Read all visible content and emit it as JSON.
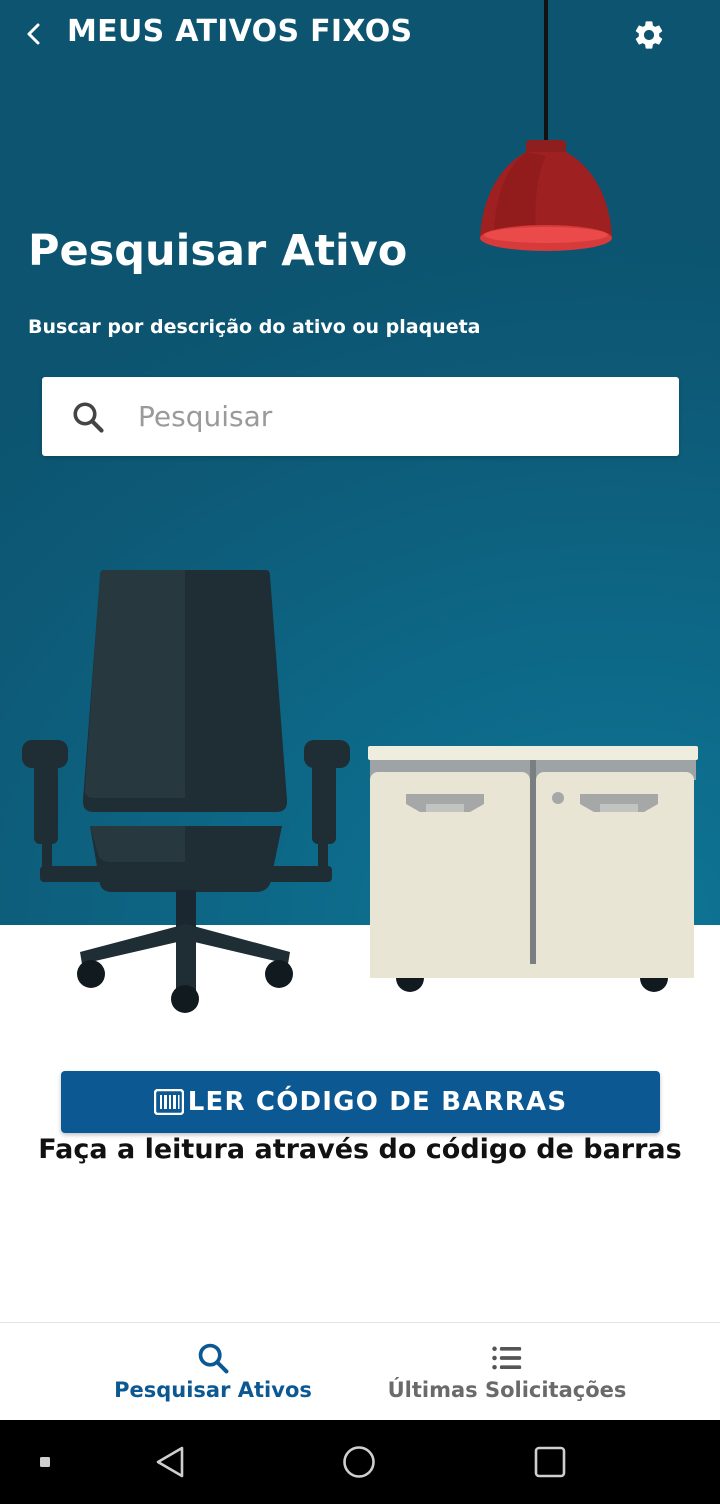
{
  "header": {
    "title": "MEUS ATIVOS FIXOS",
    "back_icon": "chevron-left-icon",
    "settings_icon": "gear-icon"
  },
  "main": {
    "title": "Pesquisar Ativo",
    "subtitle": "Buscar por descrição do ativo ou plaqueta",
    "search": {
      "placeholder": "Pesquisar",
      "value": "",
      "icon": "search-icon"
    },
    "scan_button": {
      "label": "LER CÓDIGO DE BARRAS",
      "icon": "barcode-icon"
    },
    "scan_hint": "Faça a leitura através do código de barras"
  },
  "bottom_nav": {
    "items": [
      {
        "label": "Pesquisar Ativos",
        "icon": "search-icon",
        "active": true
      },
      {
        "label": "Últimas Solicitações",
        "icon": "list-icon",
        "active": false
      }
    ]
  },
  "system_nav": [
    "stop-icon",
    "back-triangle-icon",
    "home-circle-icon",
    "recents-square-icon"
  ],
  "colors": {
    "hero_background": "#0d6281",
    "primary": "#0c5892",
    "lamp": "#a0201f",
    "chair": "#22313a",
    "cabinet": "#e8e5d4"
  }
}
